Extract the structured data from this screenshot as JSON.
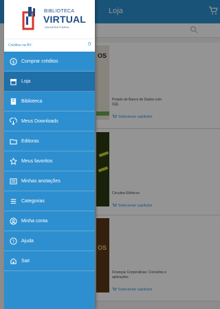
{
  "app": {
    "title": "Loja"
  },
  "cards": [
    {
      "title": "Projeto de Banco de Dados com SQL",
      "select_label": "Selecionar capítulos",
      "cover_color": "#e8e4d8",
      "cover_text": "OS"
    },
    {
      "title": "Circuitos Elétricos",
      "select_label": "Selecionar capítulos",
      "cover_color": "#2b3a12",
      "cover_text": ""
    },
    {
      "title": "Finanças Corporativas: Conceitos e aplicações",
      "select_label": "Selecionar capítulos",
      "cover_color": "#5a3a18",
      "cover_text": "OS"
    }
  ],
  "drawer": {
    "logo": {
      "top": "BIBLIOTECA",
      "main": "VIRTUAL",
      "sub": "UNIVERSITÁRIA"
    },
    "credits_label": "Créditos na BV:",
    "credits_value": "0",
    "items": [
      {
        "label": "Comprar créditos",
        "icon": "coin-icon",
        "active": false
      },
      {
        "label": "Loja",
        "icon": "store-icon",
        "active": true
      },
      {
        "label": "Biblioteca",
        "icon": "library-icon",
        "active": false
      },
      {
        "label": "Meus Downloads",
        "icon": "download-icon",
        "active": false
      },
      {
        "label": "Editoras",
        "icon": "folder-icon",
        "active": false
      },
      {
        "label": "Meus favoritos",
        "icon": "star-icon",
        "active": false
      },
      {
        "label": "Minhas anotações",
        "icon": "notes-icon",
        "active": false
      },
      {
        "label": "Categorias",
        "icon": "list-icon",
        "active": false
      },
      {
        "label": "Minha conta",
        "icon": "user-icon",
        "active": false
      },
      {
        "label": "Ajuda",
        "icon": "help-icon",
        "active": false
      },
      {
        "label": "Sair",
        "icon": "exit-icon",
        "active": false
      }
    ]
  },
  "colors": {
    "brand_blue": "#2d8fcf",
    "active_blue": "#1f6fa8",
    "logo_blue": "#1f4e88",
    "logo_red": "#d9342b"
  }
}
